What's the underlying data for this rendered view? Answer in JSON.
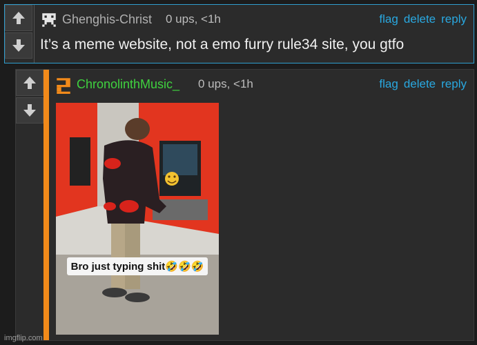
{
  "comments": [
    {
      "username": "Ghenghis-Christ",
      "username_color": "#b0b0b0",
      "ups": "0 ups, <1h",
      "actions": [
        "flag",
        "delete",
        "reply"
      ],
      "text": "It’s a meme website, not a emo furry rule34 site, you gtfo"
    },
    {
      "username": "ChronolinthMusic_",
      "username_color": "#3fd23f",
      "ups": "0 ups, <1h",
      "actions": [
        "flag",
        "delete",
        "reply"
      ],
      "image": {
        "caption": "Bro just typing shit🤣🤣🤣"
      }
    }
  ],
  "watermark": "imgflip.com",
  "colors": {
    "accent_blue": "#29a8e0",
    "reply_bar": "#f28a1a",
    "atm_red": "#e2351f"
  },
  "icons": [
    "upvote-arrow-icon",
    "downvote-arrow-icon",
    "pixel-avatar-icon"
  ]
}
